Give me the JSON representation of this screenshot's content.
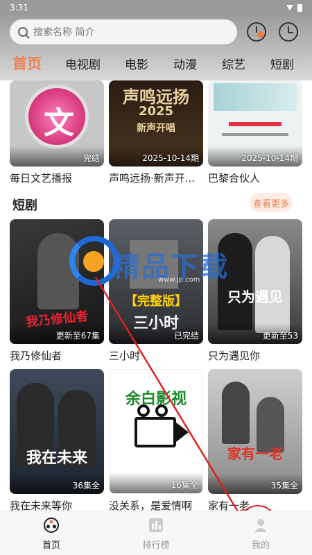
{
  "status": {
    "time": "3:31"
  },
  "search": {
    "placeholder": "搜索名称 简介"
  },
  "tabs": [
    "首页",
    "电视剧",
    "电影",
    "动漫",
    "综艺",
    "短剧"
  ],
  "top_row": [
    {
      "title": "每日文艺播报",
      "badge": "完结"
    },
    {
      "title": "声鸣远扬·新声开...",
      "badge": "2025-10-14期",
      "poster_text": "声鸣远扬",
      "poster_year": "2025",
      "poster_sub": "新声开唱"
    },
    {
      "title": "巴黎合伙人",
      "badge": "2025-10-14期"
    }
  ],
  "section": {
    "title": "短剧",
    "more_label": "查看更多"
  },
  "grid": [
    {
      "title": "我乃修仙者",
      "badge": "更新至67集",
      "poster_text": "我乃修仙者"
    },
    {
      "title": "三小时",
      "badge": "已完结",
      "poster_text": "三小时",
      "poster_tag": "【完整版】"
    },
    {
      "title": "只为遇见你",
      "badge": "更新至53",
      "poster_text": "只为遇见"
    },
    {
      "title": "我在未来等你",
      "badge": "36集全",
      "poster_text": "我在未来"
    },
    {
      "title": "没关系，是爱情啊",
      "badge": "16集全",
      "poster_text": "余白影视"
    },
    {
      "title": "家有一老",
      "badge": "35集全",
      "poster_text": "家有一老"
    }
  ],
  "watermark": {
    "text": "精品下载",
    "sub": "www.jp.com"
  },
  "bottom_nav": [
    {
      "label": "首页",
      "active": true
    },
    {
      "label": "排行榜",
      "active": false
    },
    {
      "label": "我的",
      "active": false
    }
  ]
}
